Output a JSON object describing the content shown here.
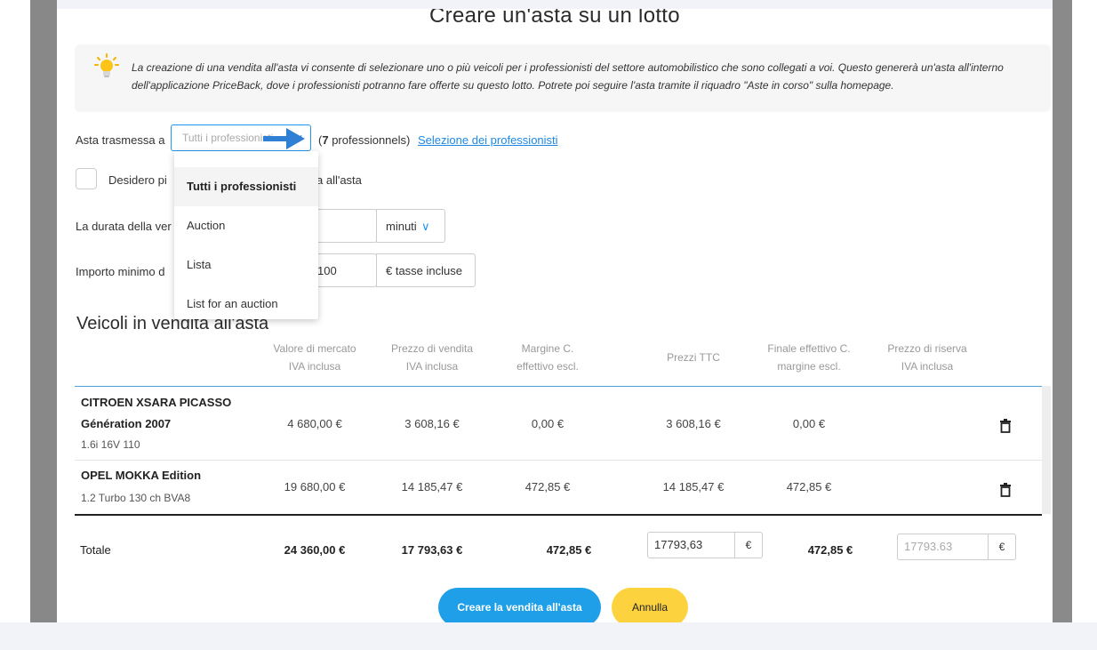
{
  "dialog": {
    "title": "Creare un'asta su un lotto",
    "info_text": "La creazione di una vendita all'asta vi consente di selezionare uno o più veicoli per i professionisti del settore automobilistico che sono collegati a voi. Questo genererà un'asta all'interno dell'applicazione PriceBack, dove i professionisti potranno fare offerte su questo lotto. Potrete poi seguire l'asta tramite il riquadro \"Aste in corso\" sulla homepage.",
    "info_icon": "lightbulb-icon"
  },
  "broadcast": {
    "label": "Asta trasmessa a",
    "select_value": "Tutti i professionisti",
    "count_number": "7",
    "count_suffix": " professionnels)",
    "count_prefix": "(",
    "link": "Selezione dei professionisti"
  },
  "dropdown": {
    "options": [
      "Tutti i professionisti",
      "Auction",
      "Lista",
      "List for an auction"
    ],
    "selected": "Tutti i professionisti"
  },
  "checkbox_row": {
    "label_left": "Desidero pi",
    "label_right": "a all'asta"
  },
  "duration": {
    "label": "La durata della ver",
    "unit": "minuti"
  },
  "min_amount": {
    "label": "Importo minimo d",
    "value": "100",
    "unit": "€ tasse incluse"
  },
  "vehicles": {
    "section_title": "Veicoli in vendita all'asta",
    "columns": [
      [
        "Valore di mercato",
        "IVA inclusa"
      ],
      [
        "Prezzo di vendita",
        "IVA inclusa"
      ],
      [
        "Margine C.",
        "effettivo escl."
      ],
      [
        "Prezzi TTC"
      ],
      [
        "Finale effettivo C.",
        "margine escl."
      ],
      [
        "Prezzo di riserva",
        "IVA inclusa"
      ]
    ],
    "rows": [
      {
        "name": "CITROEN XSARA PICASSO",
        "name2": "Génération 2007",
        "version": "1.6i 16V 110",
        "market_value": "4 680,00 €",
        "sale_price": "3 608,16 €",
        "margin": "0,00 €",
        "price_ttc": "3 608,16 €",
        "final": "0,00 €"
      },
      {
        "name": "OPEL MOKKA Edition",
        "version": "1.2 Turbo 130 ch BVA8",
        "market_value": "19 680,00 €",
        "sale_price": "14 185,47 €",
        "margin": "472,85 €",
        "price_ttc": "14 185,47 €",
        "final": "472,85 €"
      }
    ],
    "total": {
      "label": "Totale",
      "market_value": "24 360,00 €",
      "sale_price": "17 793,63 €",
      "margin": "472,85 €",
      "price_input": "17793,63",
      "currency": "€",
      "final": "472,85 €",
      "reserve_placeholder": "17793.63",
      "reserve_currency": "€"
    }
  },
  "actions": {
    "submit": "Creare la vendita all'asta",
    "cancel": "Annulla"
  },
  "colors": {
    "primary": "#1e9fe8",
    "cancel": "#fcd23f",
    "link": "#1e88e5"
  }
}
